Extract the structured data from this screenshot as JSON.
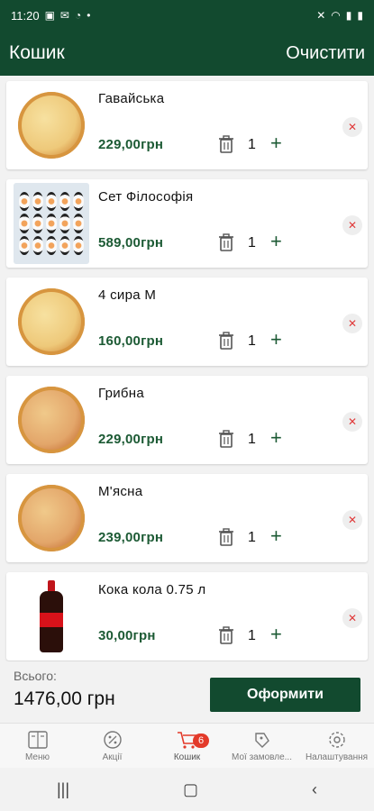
{
  "status": {
    "time": "11:20"
  },
  "header": {
    "title": "Кошик",
    "clear_label": "Очистити"
  },
  "cart": {
    "items": [
      {
        "name": "Гавайська",
        "price": "229,00грн",
        "qty": "1",
        "image": "pizza-hawaiian"
      },
      {
        "name": "Сет Філософія",
        "price": "589,00грн",
        "qty": "1",
        "image": "sushi-set"
      },
      {
        "name": "4 сира М",
        "price": "160,00грн",
        "qty": "1",
        "image": "pizza-cheese"
      },
      {
        "name": "Грибна",
        "price": "229,00грн",
        "qty": "1",
        "image": "pizza-mushroom"
      },
      {
        "name": "М'ясна",
        "price": "239,00грн",
        "qty": "1",
        "image": "pizza-meat"
      },
      {
        "name": "Кока кола 0.75 л",
        "price": "30,00грн",
        "qty": "1",
        "image": "coca-cola-bottle"
      }
    ]
  },
  "summary": {
    "total_label": "Всього:",
    "total_value": "1476,00 грн",
    "checkout_label": "Оформити"
  },
  "tabs": [
    {
      "label": "Меню",
      "icon": "menu-book-icon"
    },
    {
      "label": "Акції",
      "icon": "percent-badge-icon"
    },
    {
      "label": "Кошик",
      "icon": "cart-icon",
      "badge": "6",
      "active": true
    },
    {
      "label": "Мої замовле...",
      "icon": "orders-icon"
    },
    {
      "label": "Налаштування",
      "icon": "settings-gear-icon"
    }
  ],
  "colors": {
    "primary": "#124a2f",
    "price": "#1c5a34",
    "badge": "#e33a2a",
    "remove": "#e03a3a"
  }
}
